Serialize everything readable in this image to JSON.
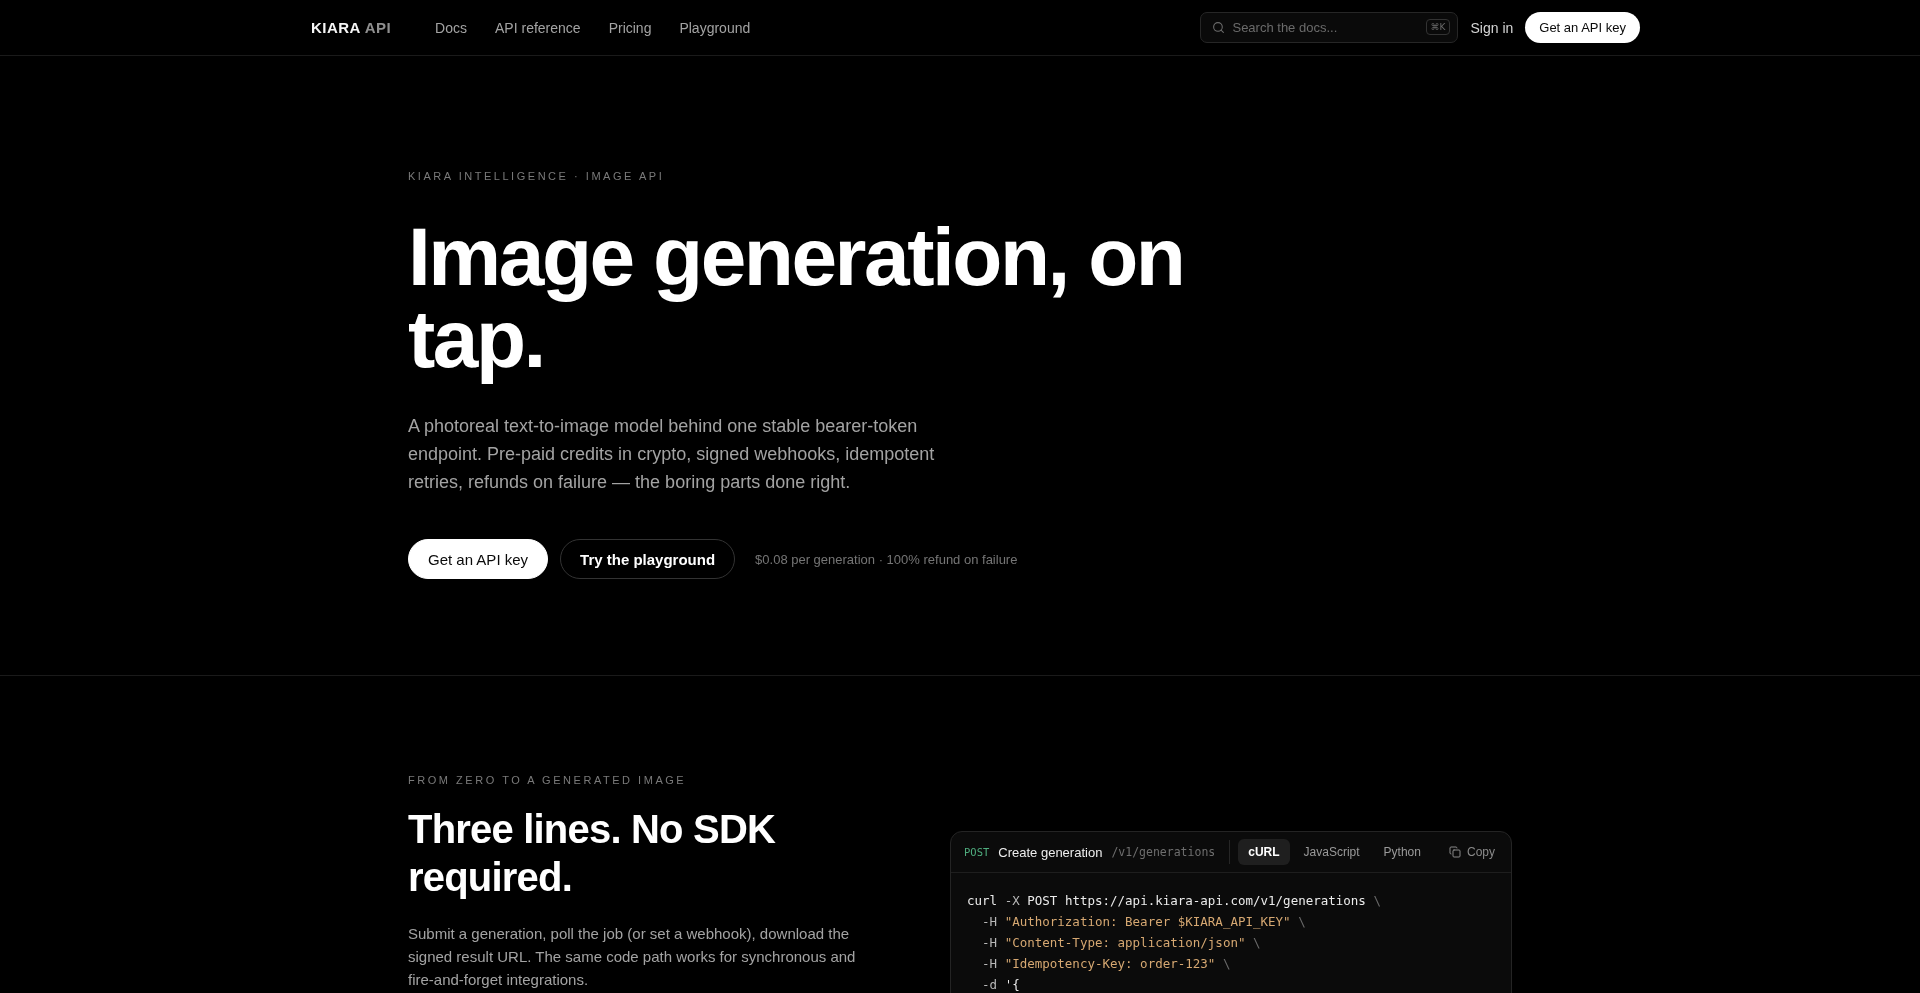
{
  "header": {
    "logo": {
      "name": "KIARA",
      "suffix": "API"
    },
    "nav": [
      {
        "label": "Docs"
      },
      {
        "label": "API reference"
      },
      {
        "label": "Pricing"
      },
      {
        "label": "Playground"
      }
    ],
    "search": {
      "placeholder": "Search the docs...",
      "shortcut": "⌘K"
    },
    "sign_in": "Sign in",
    "cta": "Get an API key"
  },
  "hero": {
    "eyebrow": "KIARA INTELLIGENCE · IMAGE API",
    "title": "Image generation, on tap.",
    "description": "A photoreal text-to-image model behind one stable bearer-token endpoint. Pre-paid credits in crypto, signed webhooks, idempotent retries, refunds on failure — the boring parts done right.",
    "buttons": [
      {
        "label": "Get an API key",
        "kind": "primary"
      },
      {
        "label": "Try the playground",
        "kind": "secondary"
      }
    ],
    "note": "$0.08 per generation · 100% refund on failure"
  },
  "quickstart": {
    "eyebrow": "FROM ZERO TO A GENERATED IMAGE",
    "title": "Three lines. No SDK required.",
    "description": "Submit a generation, poll the job (or set a webhook), download the signed result URL. The same code path works for synchronous and fire-and-forget integrations.",
    "code_card": {
      "method": "POST",
      "title": "Create generation",
      "path": "/v1/generations",
      "tabs": [
        {
          "label": "cURL",
          "selected": true
        },
        {
          "label": "JavaScript",
          "selected": false
        },
        {
          "label": "Python",
          "selected": false
        }
      ],
      "copy": "Copy",
      "lines": [
        {
          "indented": false,
          "tokens": [
            {
              "kind": "plain",
              "text": "curl"
            },
            {
              "kind": "flag",
              "text": "-X"
            },
            {
              "kind": "plain",
              "text": "POST"
            },
            {
              "kind": "plain",
              "text": "https://api.kiara-api.com/v1/generations"
            },
            {
              "kind": "dim",
              "text": "\\"
            }
          ]
        },
        {
          "indented": true,
          "tokens": [
            {
              "kind": "flag",
              "text": "-H"
            },
            {
              "kind": "string",
              "text": "\"Authorization: Bearer $KIARA_API_KEY\""
            },
            {
              "kind": "dim",
              "text": "\\"
            }
          ]
        },
        {
          "indented": true,
          "tokens": [
            {
              "kind": "flag",
              "text": "-H"
            },
            {
              "kind": "string",
              "text": "\"Content-Type: application/json\""
            },
            {
              "kind": "dim",
              "text": "\\"
            }
          ]
        },
        {
          "indented": true,
          "tokens": [
            {
              "kind": "flag",
              "text": "-H"
            },
            {
              "kind": "string",
              "text": "\"Idempotency-Key: order-123\""
            },
            {
              "kind": "dim",
              "text": "\\"
            }
          ]
        },
        {
          "indented": true,
          "tokens": [
            {
              "kind": "flag",
              "text": "-d"
            },
            {
              "kind": "plain",
              "text": "'{"
            }
          ]
        }
      ]
    }
  }
}
